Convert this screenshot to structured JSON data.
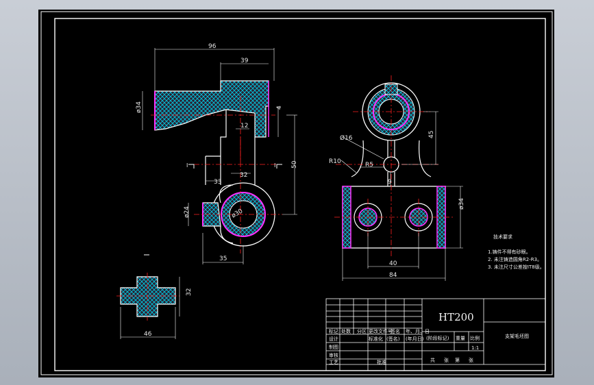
{
  "dimensions": {
    "d96": "96",
    "d39": "39",
    "d34": "ø34",
    "d4": "4",
    "d12": "12",
    "d32": "32",
    "d33": "33",
    "d50": "50",
    "d30": "ø30",
    "d24": "ø24",
    "d35": "35",
    "d46": "46",
    "d32b": "32",
    "d16": "Ø16",
    "d45": "45",
    "r10": "R10",
    "r5": "R5",
    "d9": "9",
    "d34b": "ø34",
    "d40": "40",
    "d84": "84",
    "sec1": "I",
    "sec2": "I"
  },
  "tech_notes": {
    "title": "技术要求",
    "line1": "1.铸件不得有砂眼。",
    "line2": "2. 未注铸造圆角R2-R3。",
    "line3": "3. 未注尺寸公差按IT8级。"
  },
  "title_block": {
    "material": "HT200",
    "part_name": "支架毛坯图",
    "headers": [
      "标记",
      "处数",
      "分区",
      "更改文件号",
      "签名",
      "年、月、日"
    ],
    "row_design": "设计",
    "row_std": "标准化",
    "row_sign": "(签名)",
    "row_date": "(年月日)",
    "stage_label": "(阶段标记)",
    "weight_label": "重量",
    "scale_label": "比例",
    "scale_value": "1:1",
    "row_draw": "制图",
    "row_check": "审核",
    "row_process": "工艺",
    "row_approve": "批准",
    "sheet_total": "共",
    "sheet_word": "张",
    "sheet_no": "第",
    "sheet_word2": "张"
  },
  "colors": {
    "background": "#000000",
    "frame": "#ffffff",
    "centerline": "#ff2020",
    "hatch": "#00d8ff",
    "outline": "#ff30ff",
    "dimension": "#00ffff"
  }
}
